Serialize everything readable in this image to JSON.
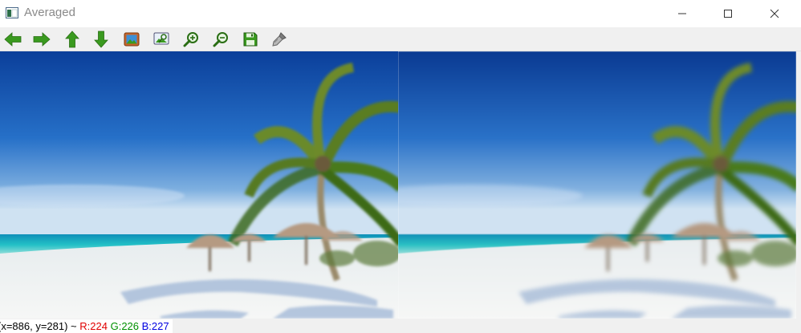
{
  "window": {
    "title": "Averaged",
    "app_icon": "opencv-window-icon",
    "controls": [
      "minimize-icon",
      "maximize-icon",
      "close-icon"
    ]
  },
  "toolbar": {
    "tools": [
      {
        "name": "pan-left",
        "icon": "arrow-left-icon"
      },
      {
        "name": "pan-right",
        "icon": "arrow-right-icon"
      },
      {
        "name": "pan-up",
        "icon": "arrow-up-icon"
      },
      {
        "name": "pan-down",
        "icon": "arrow-down-icon"
      },
      {
        "name": "zoom-to-fit",
        "icon": "picture-icon"
      },
      {
        "name": "zoom-to-original",
        "icon": "zoom-image-icon"
      },
      {
        "name": "zoom-in",
        "icon": "zoom-in-icon"
      },
      {
        "name": "zoom-out",
        "icon": "zoom-out-icon"
      },
      {
        "name": "save",
        "icon": "save-icon"
      },
      {
        "name": "properties",
        "icon": "brush-icon"
      }
    ]
  },
  "images": {
    "left": "beach with palm tree and thatched umbrellas (averaged blur)",
    "right": "beach with palm tree and thatched umbrellas (stronger blur)"
  },
  "status": {
    "coords": "(x=886, y=281) ~ ",
    "r": "R:224",
    "g": "G:226",
    "b": "B:227"
  },
  "colors": {
    "toolbar_bg": "#f0f0f0",
    "arrow_green": "#3a9a1f",
    "sky_top": "#0b3f9a",
    "sea": "#1fb7c4",
    "sand": "#f2f3f2"
  }
}
